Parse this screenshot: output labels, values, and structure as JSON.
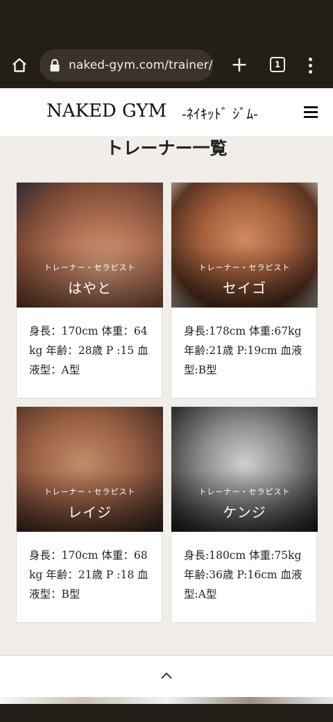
{
  "browser": {
    "url": "naked-gym.com/trainer/",
    "tab_count": "1"
  },
  "site": {
    "logo": "NAKED GYM",
    "logo_kana": "-ﾈｲｷｯﾄﾞ ｼﾞﾑ-"
  },
  "page": {
    "title": "トレーナー一覧"
  },
  "trainers": [
    {
      "role": "トレーナー・セラピスト",
      "name": "はやと",
      "profile": "身長：170cm 体重：64kg 年齢：28歳 P :15 血液型：A型"
    },
    {
      "role": "トレーナー・セラピスト",
      "name": "セイゴ",
      "profile": "身長:178cm 体重:67kg 年齢:21歳 P:19cm 血液型:B型"
    },
    {
      "role": "トレーナー・セラピスト",
      "name": "レイジ",
      "profile": "身長：170cm 体重：68kg 年齢：21歳 P :18 血液型：B型"
    },
    {
      "role": "トレーナー・セラピスト",
      "name": "ケンジ",
      "profile": "身長:180cm 体重:75kg 年齢:36歳 P:16cm 血液型:A型"
    }
  ],
  "icons": {
    "home": "home-icon",
    "lock": "lock-icon",
    "new_tab": "plus-icon",
    "tabs": "tab-switcher-icon",
    "menu": "more-vert-icon",
    "hamburger": "hamburger-menu-icon",
    "page_top": "chevron-up-icon"
  }
}
